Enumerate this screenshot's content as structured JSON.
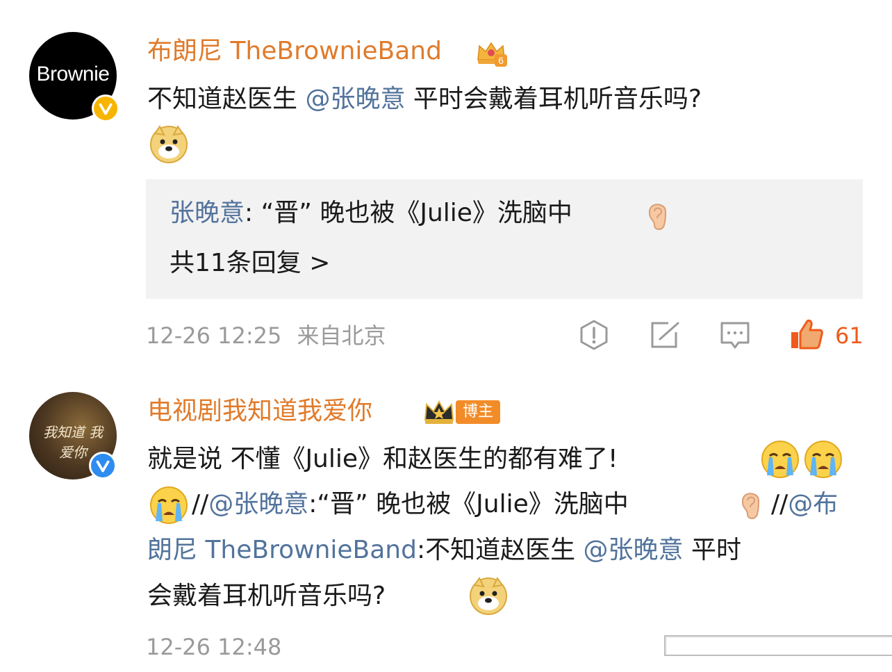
{
  "colors": {
    "name": "#e07b2b",
    "mention": "#52739c",
    "meta": "#9a9a9a",
    "reply_bg": "#f2f2f2",
    "like": "#f05a1a"
  },
  "comments": [
    {
      "avatar_text": "Brownie",
      "author": "布朗尼 TheBrownieBand",
      "badge": "6",
      "verified": "gold-v",
      "text_l1": "不知道赵医生 ",
      "mention_l1": "@张晚意",
      "text_l1_rest": " 平时会戴着耳机听音乐吗?",
      "emoji_l2": "doge-emoji",
      "reply": {
        "author": "张晚意",
        "text": ": “晋” 晚也被《Julie》洗脑中",
        "emoji": "ear-emoji",
        "more": "共11条回复 >"
      },
      "time": "12-26 12:25",
      "location": "来自北京",
      "likes": "61"
    },
    {
      "avatar_text": "我知道 我爱你",
      "author": "电视剧我知道我爱你",
      "badge": "博主",
      "verified": "blue-v",
      "l1": "就是说 不懂《Julie》和赵医生的都有难了!",
      "l2_a": "//",
      "l2_mention": "@张晚意",
      "l2_b": ":“晋” 晚也被《Julie》洗脑中",
      "l2_c": "//",
      "l2_mention2": "@布",
      "l3_mention": "朗尼 TheBrownieBand",
      "l3_b": ":不知道赵医生 ",
      "l3_mention2": "@张晚意",
      "l3_c": " 平时",
      "l4": "会戴着耳机听音乐吗?",
      "time": "12-26 12:48"
    }
  ]
}
